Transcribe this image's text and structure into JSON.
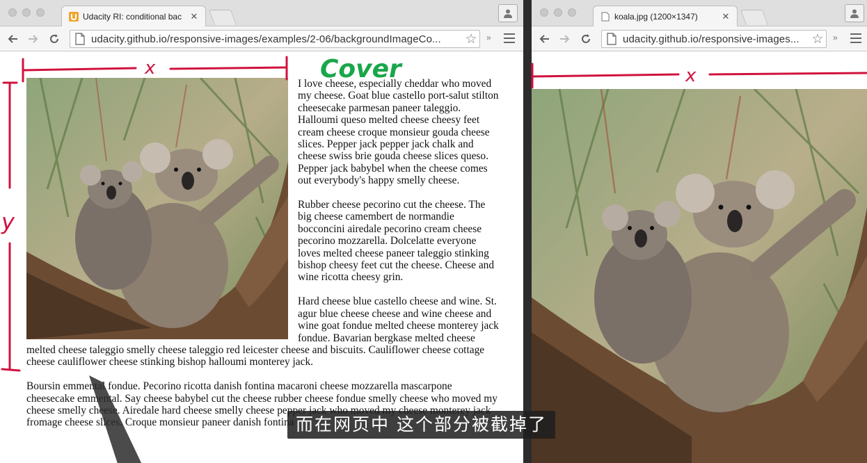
{
  "left_window": {
    "tab_title": "Udacity RI: conditional bac",
    "favicon_letter": "U",
    "url": "udacity.github.io/responsive-images/examples/2-06/backgroundImageCo...",
    "ext_chevrons": "»"
  },
  "right_window": {
    "tab_title": "koala.jpg (1200×1347)",
    "url": "udacity.github.io/responsive-images...",
    "ext_chevrons": "»"
  },
  "article": {
    "paragraphs": [
      "I love cheese, especially cheddar who moved my cheese. Goat blue castello port-salut stilton cheesecake parmesan paneer taleggio. Halloumi queso melted cheese cheesy feet cream cheese croque monsieur gouda cheese slices. Pepper jack pepper jack chalk and cheese swiss brie gouda cheese slices queso. Pepper jack babybel when the cheese comes out everybody's happy smelly cheese.",
      "Rubber cheese pecorino cut the cheese. The big cheese camembert de normandie bocconcini airedale pecorino cream cheese pecorino mozzarella. Dolcelatte everyone loves melted cheese paneer taleggio stinking bishop cheesy feet cut the cheese. Cheese and wine ricotta cheesy grin.",
      "Hard cheese blue castello cheese and wine. St. agur blue cheese cheese and wine cheese and wine goat fondue melted cheese monterey jack fondue. Bavarian bergkase melted cheese melted cheese taleggio smelly cheese taleggio red leicester cheese and biscuits. Cauliflower cheese cottage cheese cauliflower cheese stinking bishop halloumi monterey jack.",
      "Boursin emmental fondue. Pecorino ricotta danish fontina macaroni cheese mozzarella mascarpone cheesecake emmental. Say cheese babybel cut the cheese rubber cheese fondue smelly cheese who moved my cheese smelly cheese. Airedale hard cheese smelly cheese pepper jack who moved my cheese monterey jack fromage cheese slices. Croque monsieur paneer danish fontina"
    ]
  },
  "annotations": {
    "cover_label": "Cover",
    "x_label": "x",
    "y_label": "y",
    "colors": {
      "red": "#d0123e",
      "green": "#1aa64a"
    }
  },
  "subtitle": "而在网页中 这个部分被截掉了"
}
